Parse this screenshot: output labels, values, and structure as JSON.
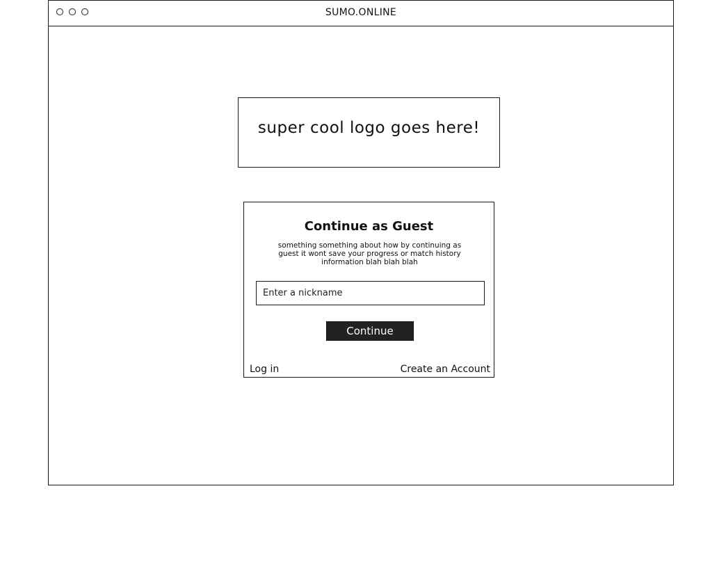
{
  "window": {
    "title": "SUMO.ONLINE",
    "controls": [
      "circle-icon",
      "circle-icon",
      "circle-icon"
    ]
  },
  "logo": {
    "text": "super cool logo goes here!"
  },
  "guest_card": {
    "title": "Continue as Guest",
    "description": "something something about how by continuing as guest it wont save your progress or match history information blah blah blah",
    "nickname_input": {
      "value": "",
      "placeholder": "Enter a nickname"
    },
    "continue_label": "Continue",
    "login_label": "Log in",
    "create_account_label": "Create an Account"
  }
}
